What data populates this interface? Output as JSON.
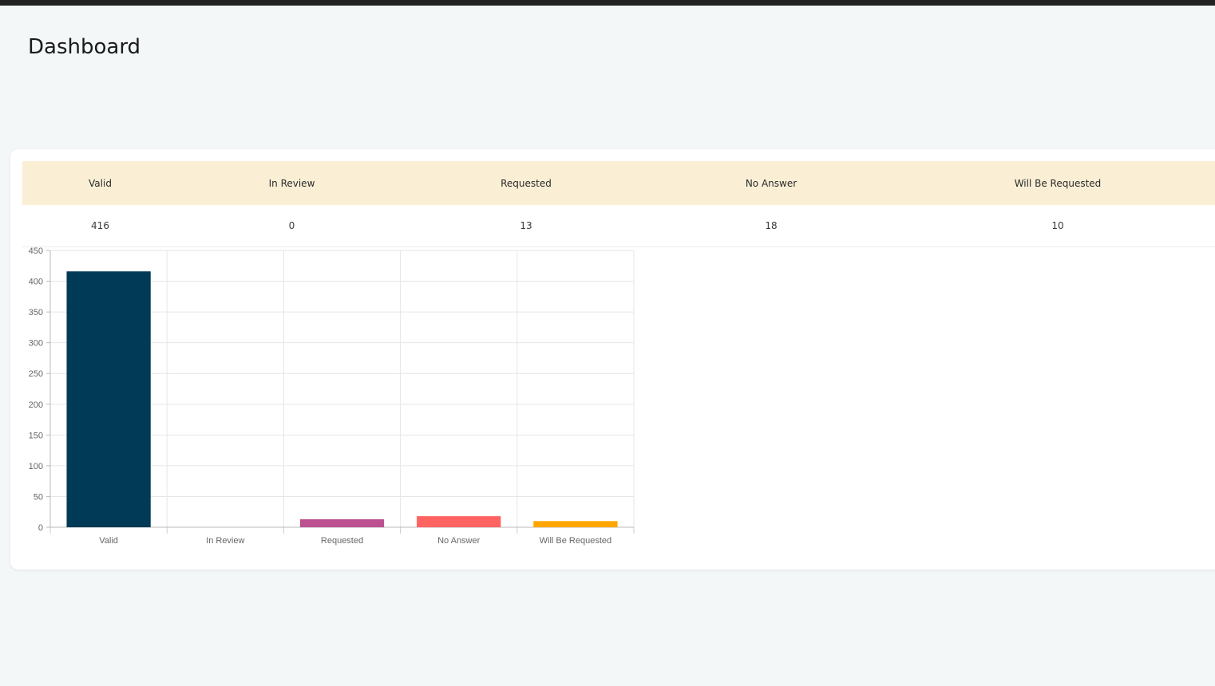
{
  "page": {
    "title": "Dashboard"
  },
  "summary": {
    "headers": [
      "Valid",
      "In Review",
      "Requested",
      "No Answer",
      "Will Be Requested"
    ],
    "values": [
      "416",
      "0",
      "13",
      "18",
      "10"
    ]
  },
  "chart_data": {
    "type": "bar",
    "categories": [
      "Valid",
      "In Review",
      "Requested",
      "No Answer",
      "Will Be Requested"
    ],
    "values": [
      416,
      0,
      13,
      18,
      10
    ],
    "colors": [
      "#003a57",
      "#7a5195",
      "#bc5090",
      "#ff6361",
      "#ffa600"
    ],
    "ylim": [
      0,
      450
    ],
    "yticks": [
      0,
      50,
      100,
      150,
      200,
      250,
      300,
      350,
      400,
      450
    ],
    "grid": true,
    "legend": "none"
  }
}
